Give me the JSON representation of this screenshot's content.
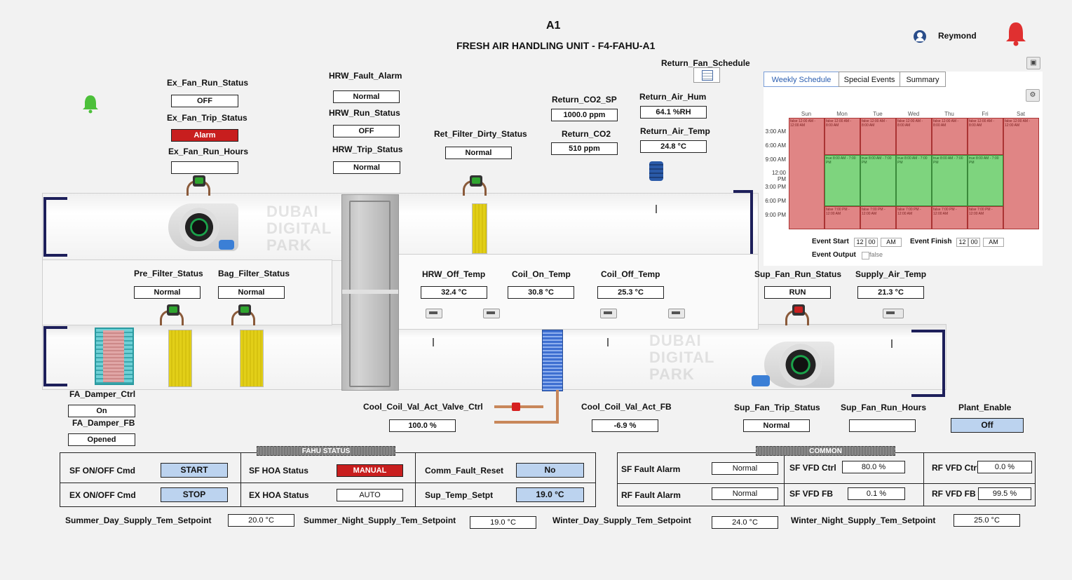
{
  "header": {
    "title": "A1",
    "subtitle": "FRESH AIR HANDLING UNIT - F4-FAHU-A1",
    "user": "Reymond"
  },
  "colors": {
    "alarm_red": "#c81e1e",
    "ok_green": "#2fa52f",
    "button_blue": "#bcd3ef",
    "duct_frame": "#1d1f5a",
    "schedule_false": "#e08585",
    "schedule_true": "#7ed47e"
  },
  "icons": {
    "user": "user-icon",
    "alarm_bell": "bell-icon",
    "status_bell": "bell-icon",
    "save": "save-icon",
    "gear": "gear-icon",
    "calendar": "calendar-icon"
  },
  "points": {
    "ex_fan_run_status": {
      "label": "Ex_Fan_Run_Status",
      "value": "OFF"
    },
    "ex_fan_trip_status": {
      "label": "Ex_Fan_Trip_Status",
      "value": "Alarm"
    },
    "ex_fan_run_hours": {
      "label": "Ex_Fan_Run_Hours",
      "value": ""
    },
    "hrw_fault_alarm": {
      "label": "HRW_Fault_Alarm",
      "value": "Normal"
    },
    "hrw_run_status": {
      "label": "HRW_Run_Status",
      "value": "OFF"
    },
    "hrw_trip_status": {
      "label": "HRW_Trip_Status",
      "value": "Normal"
    },
    "ret_filter_dirty_status": {
      "label": "Ret_Filter_Dirty_Status",
      "value": "Normal"
    },
    "return_co2_sp": {
      "label": "Return_CO2_SP",
      "value": "1000.0 ppm"
    },
    "return_co2": {
      "label": "Return_CO2",
      "value": "510 ppm"
    },
    "return_air_hum": {
      "label": "Return_Air_Hum",
      "value": "64.1 %RH"
    },
    "return_air_temp": {
      "label": "Return_Air_Temp",
      "value": "24.8 °C"
    },
    "return_fan_schedule": {
      "label": "Return_Fan_Schedule"
    },
    "pre_filter_status": {
      "label": "Pre_Filter_Status",
      "value": "Normal"
    },
    "bag_filter_status": {
      "label": "Bag_Filter_Status",
      "value": "Normal"
    },
    "hrw_off_temp": {
      "label": "HRW_Off_Temp",
      "value": "32.4 °C"
    },
    "coil_on_temp": {
      "label": "Coil_On_Temp",
      "value": "30.8 °C"
    },
    "coil_off_temp": {
      "label": "Coil_Off_Temp",
      "value": "25.3 °C"
    },
    "sup_fan_run_status": {
      "label": "Sup_Fan_Run_Status",
      "value": "RUN"
    },
    "supply_air_temp": {
      "label": "Supply_Air_Temp",
      "value": "21.3 °C"
    },
    "fa_damper_ctrl": {
      "label": "FA_Damper_Ctrl",
      "value": "On"
    },
    "fa_damper_fb": {
      "label": "FA_Damper_FB",
      "value": "Opened"
    },
    "cool_coil_val_act_valve_ctrl": {
      "label": "Cool_Coil_Val_Act_Valve_Ctrl",
      "value": "100.0 %"
    },
    "cool_coil_val_act_fb": {
      "label": "Cool_Coil_Val_Act_FB",
      "value": "-6.9 %"
    },
    "sup_fan_trip_status": {
      "label": "Sup_Fan_Trip_Status",
      "value": "Normal"
    },
    "sup_fan_run_hours": {
      "label": "Sup_Fan_Run_Hours",
      "value": ""
    },
    "plant_enable": {
      "label": "Plant_Enable",
      "value": "Off"
    }
  },
  "watermark": [
    "DUBAI",
    "DIGITAL",
    "PARK"
  ],
  "fahu_status": {
    "title": "FAHU STATUS",
    "sf_onoff": {
      "label": "SF ON/OFF Cmd",
      "value": "START"
    },
    "ex_onoff": {
      "label": "EX ON/OFF Cmd",
      "value": "STOP"
    },
    "sf_hoa": {
      "label": "SF HOA Status",
      "value": "MANUAL"
    },
    "ex_hoa": {
      "label": "EX HOA Status",
      "value": "AUTO"
    },
    "comm_fault_reset": {
      "label": "Comm_Fault_Reset",
      "value": "No"
    },
    "sup_temp_setpt": {
      "label": "Sup_Temp_Setpt",
      "value": "19.0 °C"
    }
  },
  "common": {
    "title": "COMMON",
    "sf_fault_alarm": {
      "label": "SF Fault Alarm",
      "value": "Normal"
    },
    "rf_fault_alarm": {
      "label": "RF Fault Alarm",
      "value": "Normal"
    },
    "sf_vfd_ctrl": {
      "label": "SF VFD Ctrl",
      "value": "80.0 %"
    },
    "sf_vfd_fb": {
      "label": "SF VFD FB",
      "value": "0.1 %"
    },
    "rf_vfd_ctrl": {
      "label": "RF VFD Ctrl",
      "value": "0.0 %"
    },
    "rf_vfd_fb": {
      "label": "RF VFD FB",
      "value": "99.5 %"
    }
  },
  "setpoints": {
    "summer_day": {
      "label": "Summer_Day_Supply_Tem_Setpoint",
      "value": "20.0 °C"
    },
    "summer_night": {
      "label": "Summer_Night_Supply_Tem_Setpoint",
      "value": "19.0 °C"
    },
    "winter_day": {
      "label": "Winter_Day_Supply_Tem_Setpoint",
      "value": "24.0 °C"
    },
    "winter_night": {
      "label": "Winter_Night_Supply_Tem_Setpoint",
      "value": "25.0 °C"
    }
  },
  "schedule": {
    "tabs": [
      "Weekly Schedule",
      "Special Events",
      "Summary"
    ],
    "active_tab": "Weekly Schedule",
    "days": [
      "Sun",
      "Mon",
      "Tue",
      "Wed",
      "Thu",
      "Fri",
      "Sat"
    ],
    "times": [
      "3:00 AM",
      "6:00 AM",
      "9:00 AM",
      "12:00 PM",
      "3:00 PM",
      "6:00 PM",
      "9:00 PM"
    ],
    "blocks": {
      "false_early": "false\n12:00 AM - 8:00 AM",
      "false_allday": "false\n12:00 AM - 12:00 AM",
      "true_mid": "true\n8:00 AM - 7:00 PM",
      "false_late": "false\n7:00 PM - 12:00 AM"
    },
    "event_start_label": "Event Start",
    "event_finish_label": "Event Finish",
    "event_output_label": "Event Output",
    "start_hour": "12",
    "start_min": "00",
    "start_ampm": "AM",
    "finish_hour": "12",
    "finish_min": "00",
    "finish_ampm": "AM",
    "event_output_value": "false"
  }
}
